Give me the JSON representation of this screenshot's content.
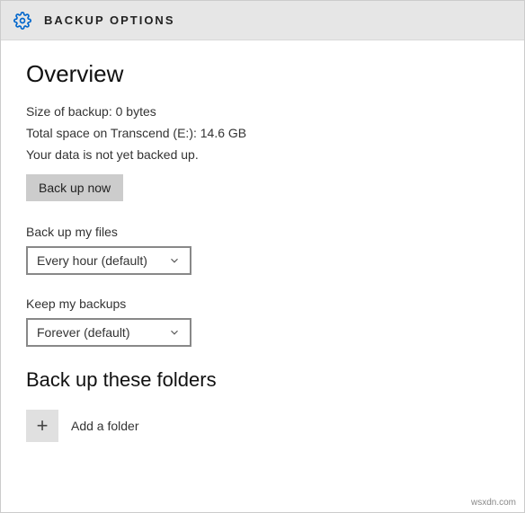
{
  "header": {
    "title": "BACKUP OPTIONS"
  },
  "overview": {
    "title": "Overview",
    "size_line": "Size of backup: 0 bytes",
    "space_line": "Total space on Transcend (E:): 14.6 GB",
    "status_line": "Your data is not yet backed up.",
    "backup_button": "Back up now"
  },
  "frequency": {
    "label": "Back up my files",
    "value": "Every hour (default)"
  },
  "retention": {
    "label": "Keep my backups",
    "value": "Forever (default)"
  },
  "folders": {
    "title": "Back up these folders",
    "add_label": "Add a folder"
  },
  "watermark": "wsxdn.com"
}
